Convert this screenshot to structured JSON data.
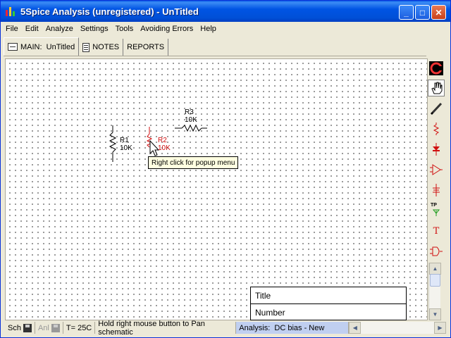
{
  "window": {
    "title": "5Spice Analysis (unregistered) - UnTitled",
    "controls": {
      "minimize": "_",
      "maximize": "□",
      "close": "✕"
    }
  },
  "menu": [
    "File",
    "Edit",
    "Analyze",
    "Settings",
    "Tools",
    "Avoiding Errors",
    "Help"
  ],
  "tabs": [
    {
      "label": "MAIN:  UnTitled",
      "icon": "schematic-icon",
      "active": true
    },
    {
      "label": "NOTES",
      "icon": "notes-icon",
      "active": false
    },
    {
      "label": "REPORTS",
      "active": false
    }
  ],
  "schematic": {
    "components": [
      {
        "ref": "R1",
        "value": "10K",
        "selected": false
      },
      {
        "ref": "R2",
        "value": "10K",
        "selected": true
      },
      {
        "ref": "R3",
        "value": "10K",
        "selected": false
      }
    ],
    "tooltip": "Right click for popup menu"
  },
  "title_block": {
    "title_label": "Title",
    "number_label": "Number"
  },
  "toolbar": [
    {
      "name": "logo-tool",
      "icon": "5spice-logo-icon"
    },
    {
      "name": "pan-tool",
      "icon": "hand-icon"
    },
    {
      "name": "wire-tool",
      "icon": "pencil-icon"
    },
    {
      "name": "resistor-tool",
      "icon": "resistor-icon"
    },
    {
      "name": "diode-tool",
      "icon": "diode-icon"
    },
    {
      "name": "opamp-tool",
      "icon": "opamp-icon"
    },
    {
      "name": "ground-tool",
      "icon": "ground-icon"
    },
    {
      "name": "testpoint-tool",
      "icon": "testpoint-icon",
      "text": "TP"
    },
    {
      "name": "text-tool",
      "icon": "text-icon",
      "text": "T"
    },
    {
      "name": "gate-tool",
      "icon": "gate-icon"
    }
  ],
  "status": {
    "sch": "Sch",
    "anl": "Anl",
    "temp": "T= 25C",
    "hint": "Hold right mouse button to Pan schematic",
    "analysis": "Analysis:  DC bias - New"
  },
  "colors": {
    "accent_red": "#d01010",
    "titlebar_blue": "#0054e3",
    "analysis_bg": "#c0cff0"
  }
}
